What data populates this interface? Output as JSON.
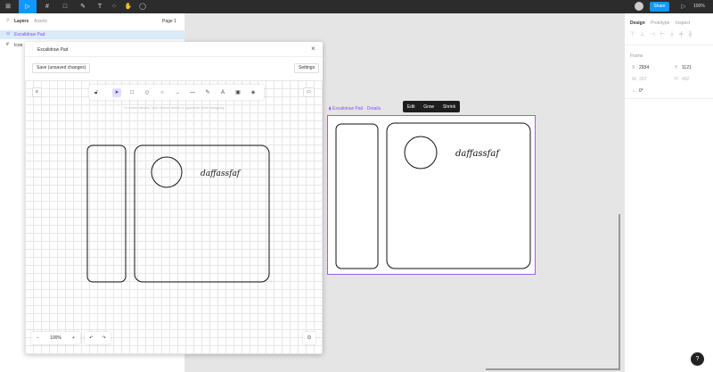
{
  "topbar": {
    "tools": [
      "figma-menu-icon",
      "move-tool-icon",
      "frame-tool-icon",
      "shape-tool-icon",
      "pen-tool-icon",
      "text-tool-icon",
      "resources-icon",
      "hand-tool-icon",
      "comment-icon"
    ],
    "share": "Share",
    "zoom": "100%",
    "accent": "#0d99ff"
  },
  "left": {
    "tabs": [
      "Layers",
      "Assets"
    ],
    "page": "Page 1",
    "layers": [
      "Excalidraw Pad",
      "Icon"
    ]
  },
  "plugin": {
    "title": "Excalidraw Pad",
    "save": "Save (unsaved changes)",
    "settings": "Settings",
    "hint": "To move canvas, hold mouse wheel or spacebar while dragging",
    "zoom": "100%",
    "drawing_text": "daffassfaf"
  },
  "canvas": {
    "frame_label": "Excalidraw Pad",
    "frame_link": "Details",
    "actions": [
      "Edit",
      "Grow",
      "Shrink"
    ],
    "drawing_text": "daffassfaf",
    "selection_color": "#a259ff"
  },
  "right": {
    "tabs": [
      "Design",
      "Prototype",
      "Inspect"
    ],
    "section": "Frame",
    "x": "2934",
    "y": "1121",
    "w": "322",
    "h": "402",
    "rotation": "0°"
  },
  "help": "?"
}
